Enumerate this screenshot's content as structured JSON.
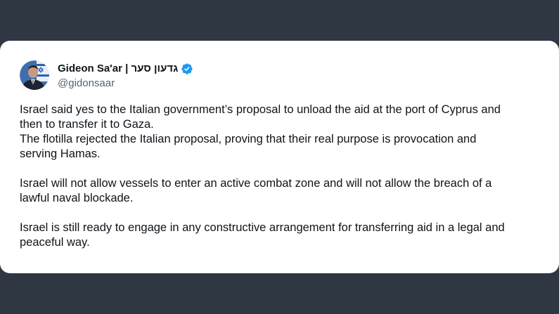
{
  "tweet": {
    "author": {
      "display_name": "Gideon Sa'ar | גדעון סער",
      "handle": "@gidonsaar",
      "verified": true,
      "avatar_icon": "profile-photo-with-israeli-flag"
    },
    "paragraphs": [
      {
        "lines": [
          "Israel said yes to the Italian government’s proposal to unload the aid at the port of Cyprus and",
          "then to transfer it to Gaza.",
          "The flotilla rejected the Italian proposal, proving that their real purpose is provocation and",
          "serving Hamas."
        ]
      },
      {
        "lines": [
          "Israel will not allow vessels to enter an active combat zone and will not allow the breach of a",
          "lawful naval blockade."
        ]
      },
      {
        "lines": [
          "Israel is still ready to engage in any constructive arrangement for transferring aid in a legal and",
          "peaceful way."
        ]
      }
    ]
  },
  "colors": {
    "background": "#2f3742",
    "card": "#ffffff",
    "text": "#0f1419",
    "secondary_text": "#536471",
    "verified_badge": "#1d9bf0"
  }
}
